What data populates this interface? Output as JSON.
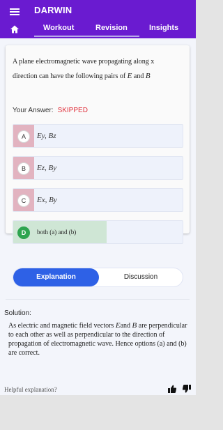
{
  "appbar": {
    "title": "DARWIN",
    "tabs": [
      "Workout",
      "Revision",
      "Insights"
    ]
  },
  "question": {
    "text_line1": "A plane electromagnetic wave propagating along x",
    "text_line2_prefix": "direction can have the following pairs of ",
    "var_e": "E",
    "and_word": " and ",
    "var_b": "B"
  },
  "answer": {
    "label": "Your Answer:",
    "status": "SKIPPED"
  },
  "options": [
    {
      "letter": "A",
      "text": "Ey, Bz"
    },
    {
      "letter": "B",
      "text": "Ez, By"
    },
    {
      "letter": "C",
      "text": "Ex, By"
    },
    {
      "letter": "D",
      "text": "both (a) and (b)"
    }
  ],
  "segment": {
    "active": "Explanation",
    "inactive": "Discussion"
  },
  "solution": {
    "label": "Solution:",
    "p1": "As electric and magnetic field vectors ",
    "var_e": "E",
    "p2": "and ",
    "var_b": "B",
    "p3": " are perpendicular to each other as well as perpendicular to the direction of propagation of electromagnetic wave. Hence options (a) and (b) are correct."
  },
  "feedback": {
    "prompt": "Helpful explanation?",
    "up_icon": "thumbs-up-icon",
    "down_icon": "thumbs-down-icon"
  },
  "colors": {
    "appbar": "#6a1bd0",
    "accent": "#2e61e6",
    "skipped": "#e0303b",
    "correct": "#2ea44f"
  }
}
